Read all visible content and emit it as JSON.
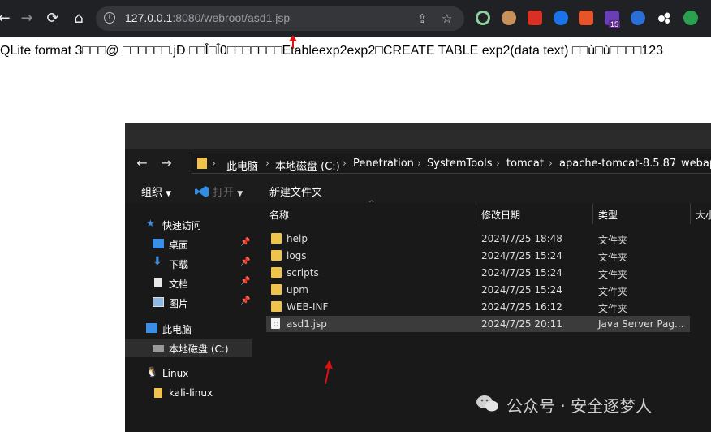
{
  "browser": {
    "url_host": "127.0.0.1",
    "url_rest": ":8080/webroot/asd1.jsp",
    "ext_badge": "15",
    "icons": [
      "back-icon",
      "forward-icon",
      "reload-icon",
      "home-icon",
      "info-icon",
      "share-icon",
      "star-icon"
    ]
  },
  "page": {
    "content_text": "QLite format 3□□□@ □□□□□□.jÐ □□Î□Î0□□□□□□□Etableexp2exp2□CREATE TABLE exp2(data text) □□ù□ù□□□□123"
  },
  "explorer": {
    "breadcrumbs": [
      "此电脑",
      "本地磁盘 (C:)",
      "Penetration",
      "SystemTools",
      "tomcat",
      "apache-tomcat-8.5.87",
      "webap"
    ],
    "toolbar": {
      "organize": "组织",
      "open": "打开",
      "new_folder": "新建文件夹"
    },
    "columns": {
      "name": "名称",
      "modified": "修改日期",
      "type": "类型",
      "size": "大小"
    },
    "sidebar": {
      "quick_access": "快速访问",
      "desktop": "桌面",
      "downloads": "下载",
      "documents": "文档",
      "pictures": "图片",
      "this_pc": "此电脑",
      "local_disk": "本地磁盘 (C:)",
      "linux": "Linux",
      "kali": "kali-linux"
    },
    "files": [
      {
        "name": "help",
        "modified": "2024/7/25 18:48",
        "type": "文件夹"
      },
      {
        "name": "logs",
        "modified": "2024/7/25 15:24",
        "type": "文件夹"
      },
      {
        "name": "scripts",
        "modified": "2024/7/25 15:24",
        "type": "文件夹"
      },
      {
        "name": "upm",
        "modified": "2024/7/25 15:24",
        "type": "文件夹"
      },
      {
        "name": "WEB-INF",
        "modified": "2024/7/25 16:12",
        "type": "文件夹"
      },
      {
        "name": "asd1.jsp",
        "modified": "2024/7/25 20:11",
        "type": "Java Server Pag..."
      }
    ]
  },
  "watermark": {
    "text": "公众号 · 安全逐梦人"
  },
  "colors": {
    "arrow": "#e01010",
    "folder": "#f0c44c",
    "selection": "#3b3b3b"
  }
}
